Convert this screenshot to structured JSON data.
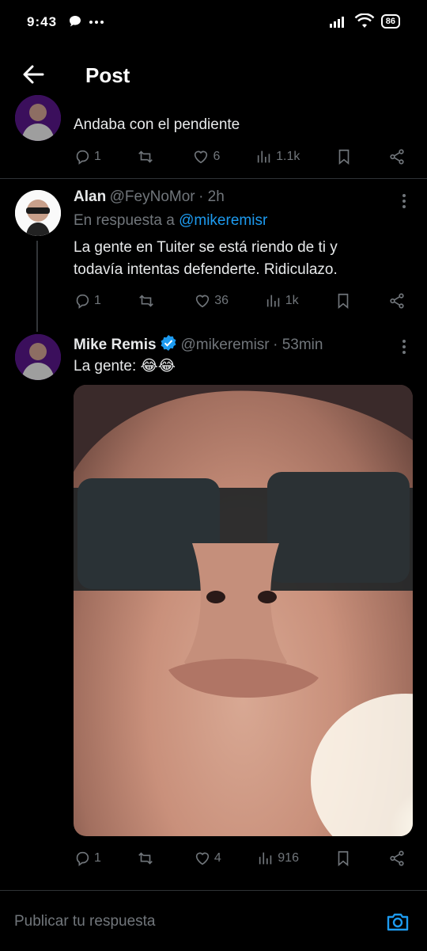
{
  "status_bar": {
    "time": "9:43",
    "battery": "86"
  },
  "header": {
    "title": "Post"
  },
  "tweet_prev": {
    "text": "Andaba con el pendiente",
    "stats": {
      "replies": "1",
      "retweets": "",
      "likes": "6",
      "views": "1.1k"
    }
  },
  "tweet_alan": {
    "name": "Alan",
    "handle": "@FeyNoMor",
    "time": "· 2h",
    "reply_prefix": "En respuesta a",
    "reply_to": "@mikeremisr",
    "text": "La gente en Tuiter se está riendo de ti y todavía intentas defenderte. Ridiculazo.",
    "stats": {
      "replies": "1",
      "retweets": "",
      "likes": "36",
      "views": "1k"
    }
  },
  "tweet_mike": {
    "name": "Mike Remis",
    "handle": "@mikeremisr",
    "time": "· 53min",
    "text": "La gente: 😂😂",
    "stats": {
      "replies": "1",
      "retweets": "",
      "likes": "4",
      "views": "916"
    }
  },
  "reply_bar": {
    "placeholder": "Publicar tu respuesta"
  },
  "colors": {
    "background": "#000000",
    "link": "#1d9bf0",
    "verified": "#1d9bf0",
    "secondary": "#71767b",
    "divider": "#2f3336"
  }
}
